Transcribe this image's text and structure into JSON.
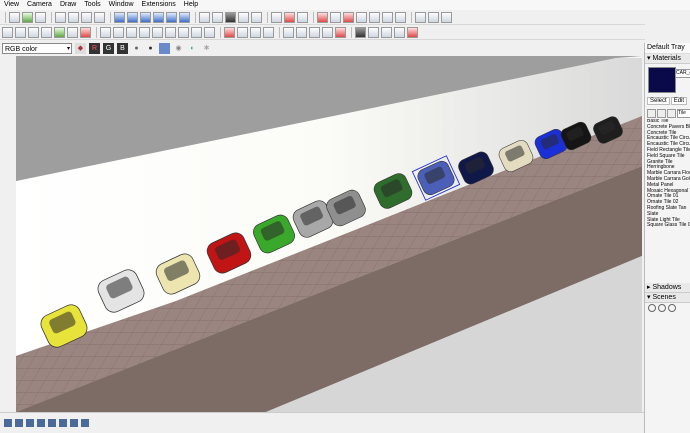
{
  "menu": [
    "View",
    "Camera",
    "Draw",
    "Tools",
    "Window",
    "Extensions",
    "Help"
  ],
  "color_mode": {
    "selected": "RGB color"
  },
  "channels": {
    "r": "R",
    "g": "G",
    "b": "B"
  },
  "tray": {
    "title": "Default Tray",
    "materials_header": "Materials",
    "current_material": "CAR_c",
    "tabs": [
      "Select",
      "Edit"
    ],
    "library": "Tile",
    "materials": [
      "Basic Tile",
      "Concrete Pavers Block",
      "Concrete Tile",
      "Encaustic Tile Circular",
      "Encaustic Tile Circular",
      "Field Rectangle Tile",
      "Field Square Tile",
      "Granite Tile",
      "Herringbone",
      "Marble Carrara Floor",
      "Marble Carrara Gold F",
      "Metal Panel",
      "Mosaic Hexagonal Tile",
      "Ornate Tile 01",
      "Ornate Tile 02",
      "Roofing Slate Tan",
      "Slate",
      "Slate Light Tile",
      "Square Glass Tile 01"
    ],
    "shadows_header": "Shadows",
    "scenes_header": "Scenes"
  },
  "colors": {
    "swatch": "#0a0a4a",
    "floor": "#9b8580",
    "wall": "#ffffff"
  },
  "cars": [
    {
      "name": "yellow-car",
      "color": "#e8e33a"
    },
    {
      "name": "white-suv",
      "color": "#e4e4e4"
    },
    {
      "name": "cream-car",
      "color": "#ece5b0"
    },
    {
      "name": "red-car",
      "color": "#c11414"
    },
    {
      "name": "green-car",
      "color": "#3aa82a"
    },
    {
      "name": "silver-car",
      "color": "#a8a8a8"
    },
    {
      "name": "gray-wagon",
      "color": "#8f8f8f"
    },
    {
      "name": "dark-green-car",
      "color": "#2f6d2d"
    },
    {
      "name": "blue-selected-car",
      "color": "#4b5fb8"
    },
    {
      "name": "navy-car",
      "color": "#10184a"
    },
    {
      "name": "beige-car",
      "color": "#e3dcc0"
    },
    {
      "name": "blue-car",
      "color": "#1a2fd8"
    },
    {
      "name": "black-car",
      "color": "#151515"
    },
    {
      "name": "black-car-2",
      "color": "#1e1e1e"
    }
  ]
}
